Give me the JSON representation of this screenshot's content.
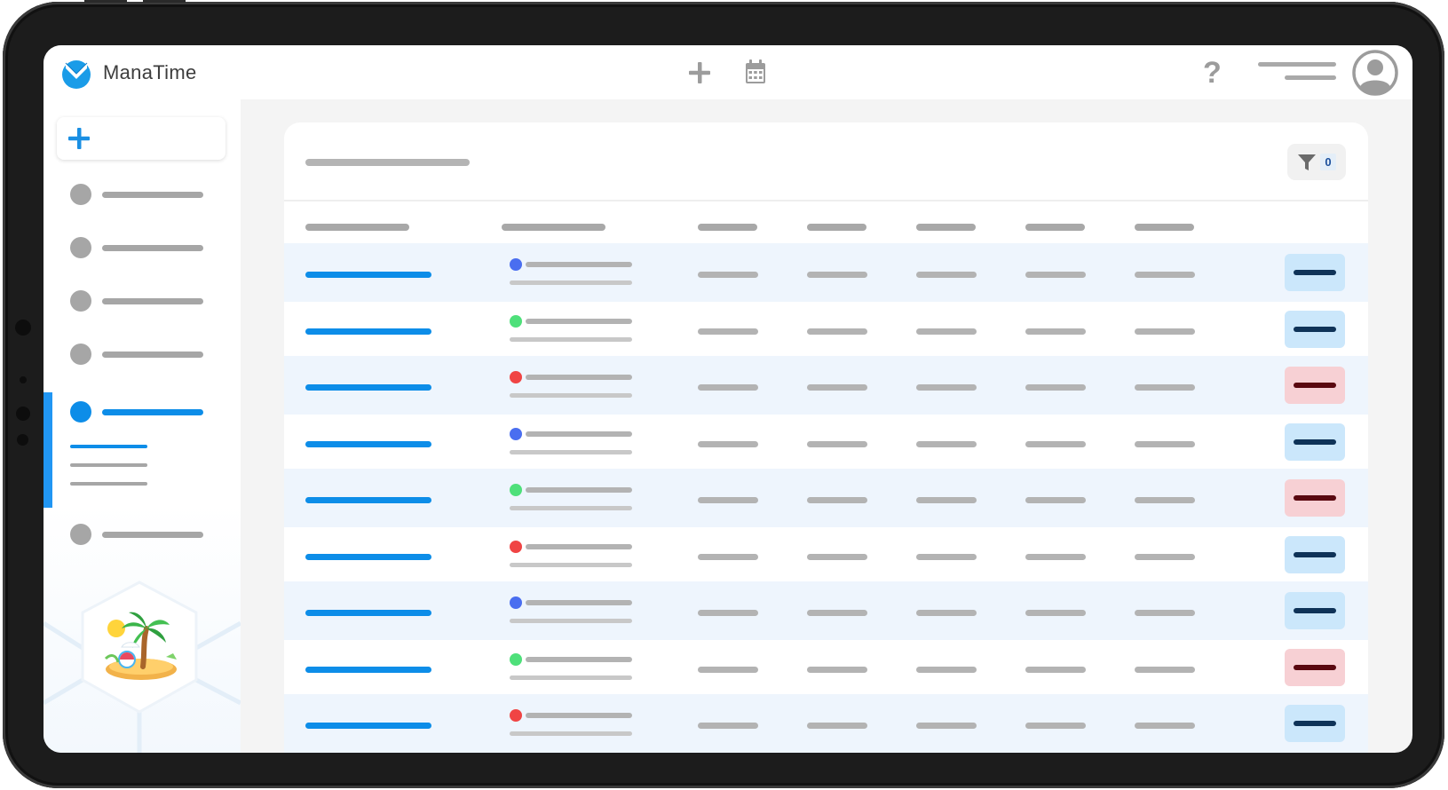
{
  "app": {
    "name": "ManaTime"
  },
  "topbar": {
    "add_icon": "plus-icon",
    "calendar_icon": "calendar-icon",
    "help_glyph": "?",
    "menu_icon": "menu-lines-icon",
    "avatar_icon": "user-avatar-icon"
  },
  "sidebar": {
    "new_button_icon": "plus-icon",
    "items": [
      {
        "active": false
      },
      {
        "active": false
      },
      {
        "active": false
      },
      {
        "active": false
      },
      {
        "active": true,
        "subitems": [
          {
            "active": true
          },
          {
            "active": false
          },
          {
            "active": false
          }
        ]
      },
      {
        "active": false
      }
    ],
    "illustration": "beach-island-illustration"
  },
  "main": {
    "filter": {
      "icon": "filter-icon",
      "count": "0"
    },
    "rows": [
      {
        "status": "blue",
        "badge": "blue"
      },
      {
        "status": "green",
        "badge": "blue"
      },
      {
        "status": "red",
        "badge": "red"
      },
      {
        "status": "blue",
        "badge": "blue"
      },
      {
        "status": "green",
        "badge": "red"
      },
      {
        "status": "red",
        "badge": "blue"
      },
      {
        "status": "blue",
        "badge": "blue"
      },
      {
        "status": "green",
        "badge": "red"
      },
      {
        "status": "red",
        "badge": "blue"
      }
    ]
  },
  "colors": {
    "accent": "#0d8de8",
    "status_blue": "#4a6ef0",
    "status_green": "#4ee07a",
    "status_red": "#f04444",
    "badge_blue_bg": "#cbe7fb",
    "badge_red_bg": "#f7d0d4"
  }
}
